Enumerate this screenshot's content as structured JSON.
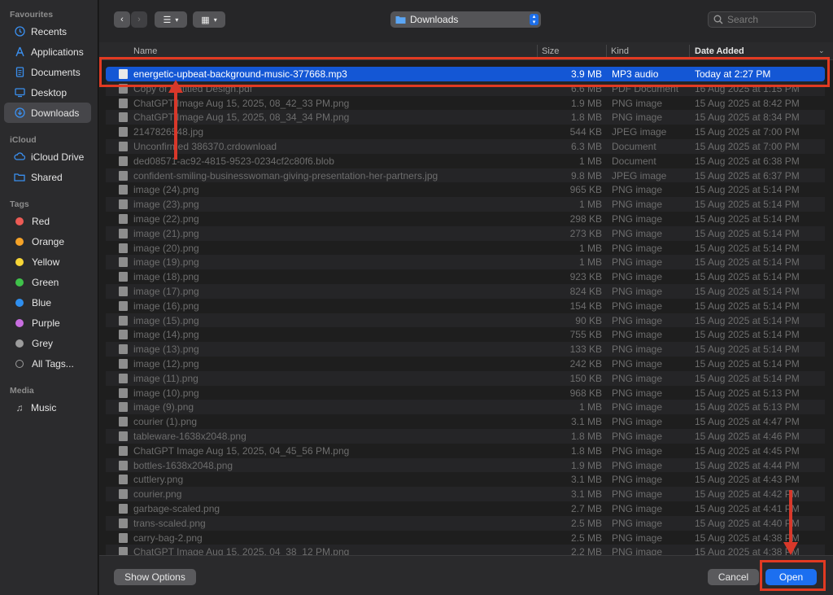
{
  "sidebar": {
    "favourites_header": "Favourites",
    "favourites": [
      {
        "label": "Recents",
        "icon": "clock-icon"
      },
      {
        "label": "Applications",
        "icon": "applications-icon"
      },
      {
        "label": "Documents",
        "icon": "document-icon"
      },
      {
        "label": "Desktop",
        "icon": "desktop-icon"
      },
      {
        "label": "Downloads",
        "icon": "download-icon",
        "selected": true
      }
    ],
    "icloud_header": "iCloud",
    "icloud": [
      {
        "label": "iCloud Drive",
        "icon": "cloud-icon"
      },
      {
        "label": "Shared",
        "icon": "shared-folder-icon"
      }
    ],
    "tags_header": "Tags",
    "tags": [
      {
        "label": "Red",
        "color": "#ec5b55"
      },
      {
        "label": "Orange",
        "color": "#f5a328"
      },
      {
        "label": "Yellow",
        "color": "#f7d537"
      },
      {
        "label": "Green",
        "color": "#3fc24a"
      },
      {
        "label": "Blue",
        "color": "#2f8ff0"
      },
      {
        "label": "Purple",
        "color": "#c86ee0"
      },
      {
        "label": "Grey",
        "color": "#9c9c9c"
      },
      {
        "label": "All Tags...",
        "color": ""
      }
    ],
    "media_header": "Media",
    "media": [
      {
        "label": "Music",
        "icon": "music-note-icon"
      }
    ]
  },
  "toolbar": {
    "location": "Downloads",
    "search_placeholder": "Search"
  },
  "columns": {
    "name": "Name",
    "size": "Size",
    "kind": "Kind",
    "date": "Date Added"
  },
  "files": [
    {
      "name": "energetic-upbeat-background-music-377668.mp3",
      "size": "3.9 MB",
      "kind": "MP3 audio",
      "date": "Today at 2:27 PM",
      "selected": true
    },
    {
      "name": "Copy of Untitled Design.pdf",
      "size": "6.6 MB",
      "kind": "PDF Document",
      "date": "16 Aug 2025 at 1:15 PM"
    },
    {
      "name": "ChatGPT Image Aug 15, 2025, 08_42_33 PM.png",
      "size": "1.9 MB",
      "kind": "PNG image",
      "date": "15 Aug 2025 at 8:42 PM"
    },
    {
      "name": "ChatGPT Image Aug 15, 2025, 08_34_34 PM.png",
      "size": "1.8 MB",
      "kind": "PNG image",
      "date": "15 Aug 2025 at 8:34 PM"
    },
    {
      "name": "2147826548.jpg",
      "size": "544 KB",
      "kind": "JPEG image",
      "date": "15 Aug 2025 at 7:00 PM"
    },
    {
      "name": "Unconfirmed 386370.crdownload",
      "size": "6.3 MB",
      "kind": "Document",
      "date": "15 Aug 2025 at 7:00 PM"
    },
    {
      "name": "ded08571-ac92-4815-9523-0234cf2c80f6.blob",
      "size": "1 MB",
      "kind": "Document",
      "date": "15 Aug 2025 at 6:38 PM"
    },
    {
      "name": "confident-smiling-businesswoman-giving-presentation-her-partners.jpg",
      "size": "9.8 MB",
      "kind": "JPEG image",
      "date": "15 Aug 2025 at 6:37 PM"
    },
    {
      "name": "image (24).png",
      "size": "965 KB",
      "kind": "PNG image",
      "date": "15 Aug 2025 at 5:14 PM"
    },
    {
      "name": "image (23).png",
      "size": "1 MB",
      "kind": "PNG image",
      "date": "15 Aug 2025 at 5:14 PM"
    },
    {
      "name": "image (22).png",
      "size": "298 KB",
      "kind": "PNG image",
      "date": "15 Aug 2025 at 5:14 PM"
    },
    {
      "name": "image (21).png",
      "size": "273 KB",
      "kind": "PNG image",
      "date": "15 Aug 2025 at 5:14 PM"
    },
    {
      "name": "image (20).png",
      "size": "1 MB",
      "kind": "PNG image",
      "date": "15 Aug 2025 at 5:14 PM"
    },
    {
      "name": "image (19).png",
      "size": "1 MB",
      "kind": "PNG image",
      "date": "15 Aug 2025 at 5:14 PM"
    },
    {
      "name": "image (18).png",
      "size": "923 KB",
      "kind": "PNG image",
      "date": "15 Aug 2025 at 5:14 PM"
    },
    {
      "name": "image (17).png",
      "size": "824 KB",
      "kind": "PNG image",
      "date": "15 Aug 2025 at 5:14 PM"
    },
    {
      "name": "image (16).png",
      "size": "154 KB",
      "kind": "PNG image",
      "date": "15 Aug 2025 at 5:14 PM"
    },
    {
      "name": "image (15).png",
      "size": "90 KB",
      "kind": "PNG image",
      "date": "15 Aug 2025 at 5:14 PM"
    },
    {
      "name": "image (14).png",
      "size": "755 KB",
      "kind": "PNG image",
      "date": "15 Aug 2025 at 5:14 PM"
    },
    {
      "name": "image (13).png",
      "size": "133 KB",
      "kind": "PNG image",
      "date": "15 Aug 2025 at 5:14 PM"
    },
    {
      "name": "image (12).png",
      "size": "242 KB",
      "kind": "PNG image",
      "date": "15 Aug 2025 at 5:14 PM"
    },
    {
      "name": "image (11).png",
      "size": "150 KB",
      "kind": "PNG image",
      "date": "15 Aug 2025 at 5:14 PM"
    },
    {
      "name": "image (10).png",
      "size": "968 KB",
      "kind": "PNG image",
      "date": "15 Aug 2025 at 5:13 PM"
    },
    {
      "name": "image (9).png",
      "size": "1 MB",
      "kind": "PNG image",
      "date": "15 Aug 2025 at 5:13 PM"
    },
    {
      "name": "courier (1).png",
      "size": "3.1 MB",
      "kind": "PNG image",
      "date": "15 Aug 2025 at 4:47 PM"
    },
    {
      "name": "tableware-1638x2048.png",
      "size": "1.8 MB",
      "kind": "PNG image",
      "date": "15 Aug 2025 at 4:46 PM"
    },
    {
      "name": "ChatGPT Image Aug 15, 2025, 04_45_56 PM.png",
      "size": "1.8 MB",
      "kind": "PNG image",
      "date": "15 Aug 2025 at 4:45 PM"
    },
    {
      "name": "bottles-1638x2048.png",
      "size": "1.9 MB",
      "kind": "PNG image",
      "date": "15 Aug 2025 at 4:44 PM"
    },
    {
      "name": "cuttlery.png",
      "size": "3.1 MB",
      "kind": "PNG image",
      "date": "15 Aug 2025 at 4:43 PM"
    },
    {
      "name": "courier.png",
      "size": "3.1 MB",
      "kind": "PNG image",
      "date": "15 Aug 2025 at 4:42 PM"
    },
    {
      "name": "garbage-scaled.png",
      "size": "2.7 MB",
      "kind": "PNG image",
      "date": "15 Aug 2025 at 4:41 PM"
    },
    {
      "name": "trans-scaled.png",
      "size": "2.5 MB",
      "kind": "PNG image",
      "date": "15 Aug 2025 at 4:40 PM"
    },
    {
      "name": "carry-bag-2.png",
      "size": "2.5 MB",
      "kind": "PNG image",
      "date": "15 Aug 2025 at 4:38 PM"
    },
    {
      "name": "ChatGPT Image Aug 15, 2025, 04_38_12 PM.png",
      "size": "2.2 MB",
      "kind": "PNG image",
      "date": "15 Aug 2025 at 4:38 PM"
    }
  ],
  "bottom": {
    "show_options": "Show Options",
    "cancel": "Cancel",
    "open": "Open"
  },
  "annotation_color": "#e23a22"
}
